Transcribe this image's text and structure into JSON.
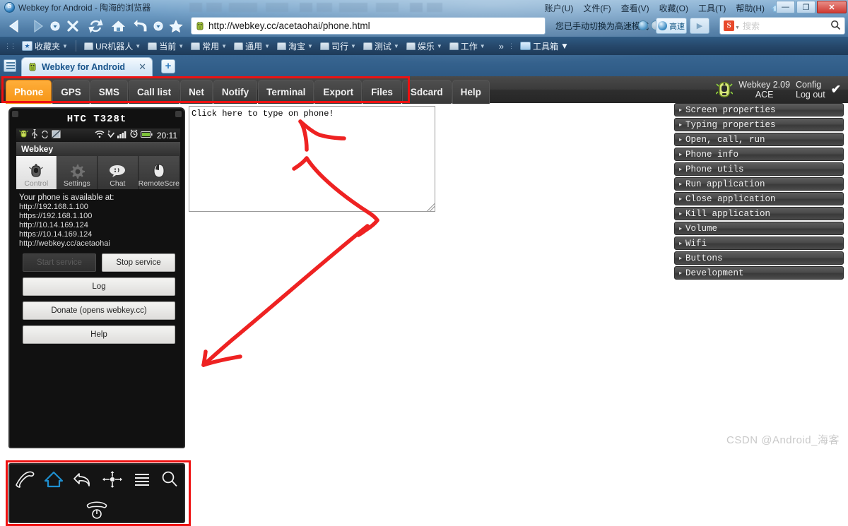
{
  "window": {
    "title": "Webkey for Android - 陶海的浏览器",
    "menu": [
      "账户(U)",
      "文件(F)",
      "查看(V)",
      "收藏(O)",
      "工具(T)",
      "帮助(H)"
    ],
    "minimize": "—",
    "maximize": "❐",
    "close": "✕"
  },
  "toolbar": {
    "back_icon": "back-icon",
    "forward_icon": "forward-icon",
    "stop_icon": "stop-icon",
    "refresh_icon": "refresh-icon",
    "home_icon": "home-icon",
    "restore_icon": "undo-icon",
    "favorite_icon": "star-icon"
  },
  "address": {
    "url": "http://webkey.cc/acetaohai/phone.html",
    "favicon": "android-robot-icon"
  },
  "speed": {
    "note": "您已手动切换为高速模式",
    "mode_label": "高速",
    "play_label": "▶"
  },
  "search": {
    "engine": "S",
    "placeholder": "搜索"
  },
  "bookmarks": {
    "favorites_label": "收藏夹",
    "items": [
      "UR机器人",
      "当前",
      "常用",
      "通用",
      "淘宝",
      "司行",
      "测试",
      "娱乐",
      "工作"
    ],
    "overflow": "»",
    "toolbox": "工具箱"
  },
  "tabstrip": {
    "tabs": [
      {
        "title": "Webkey for Android",
        "close": "✕"
      }
    ],
    "new_tab": "+"
  },
  "app": {
    "tabs": [
      "Phone",
      "GPS",
      "SMS",
      "Call list",
      "Net",
      "Notify",
      "Terminal",
      "Export",
      "Files",
      "Sdcard",
      "Help"
    ],
    "active_tab": "Phone",
    "version_line1": "Webkey 2.09",
    "version_line2": "ACE",
    "config_label": "Config",
    "logout_label": "Log out",
    "check_glyph": "✔"
  },
  "phone": {
    "model": "HTC T328t",
    "status_time": "20:11",
    "app_title": "Webkey",
    "tabs": [
      {
        "label": "Control",
        "icon": "robot-icon",
        "selected": true
      },
      {
        "label": "Settings",
        "icon": "gear-icon",
        "selected": false
      },
      {
        "label": "Chat",
        "icon": "chat-icon",
        "selected": false
      },
      {
        "label": "RemoteScre",
        "icon": "mouse-icon",
        "selected": false
      }
    ],
    "available_label": "Your phone is available at:",
    "urls": [
      "http://192.168.1.100",
      "https://192.168.1.100",
      "http://10.14.169.124",
      "https://10.14.169.124",
      "http://webkey.cc/acetaohai"
    ],
    "buttons": {
      "start_service": "Start service",
      "stop_service": "Stop service",
      "log": "Log",
      "donate": "Donate (opens webkey.cc)",
      "help": "Help"
    },
    "navbar": [
      "call-icon",
      "home-icon",
      "back-icon",
      "dpad-icon",
      "menu-icon",
      "search-icon",
      "endcall-power-icon"
    ]
  },
  "typearea": {
    "placeholder": "Click here to type on phone!"
  },
  "accordion": {
    "caret": "▸",
    "items": [
      "Screen properties",
      "Typing properties",
      "Open, call, run",
      "Phone info",
      "Phone utils",
      "Run application",
      "Close application",
      "Kill application",
      "Volume",
      "Wifi",
      "Buttons",
      "Development"
    ]
  },
  "annotation": {
    "color": "#ee2222",
    "highlight_boxes": [
      "app-tabbar",
      "phone-navbar"
    ]
  },
  "watermark": {
    "text": "CSDN @Android_海客"
  }
}
